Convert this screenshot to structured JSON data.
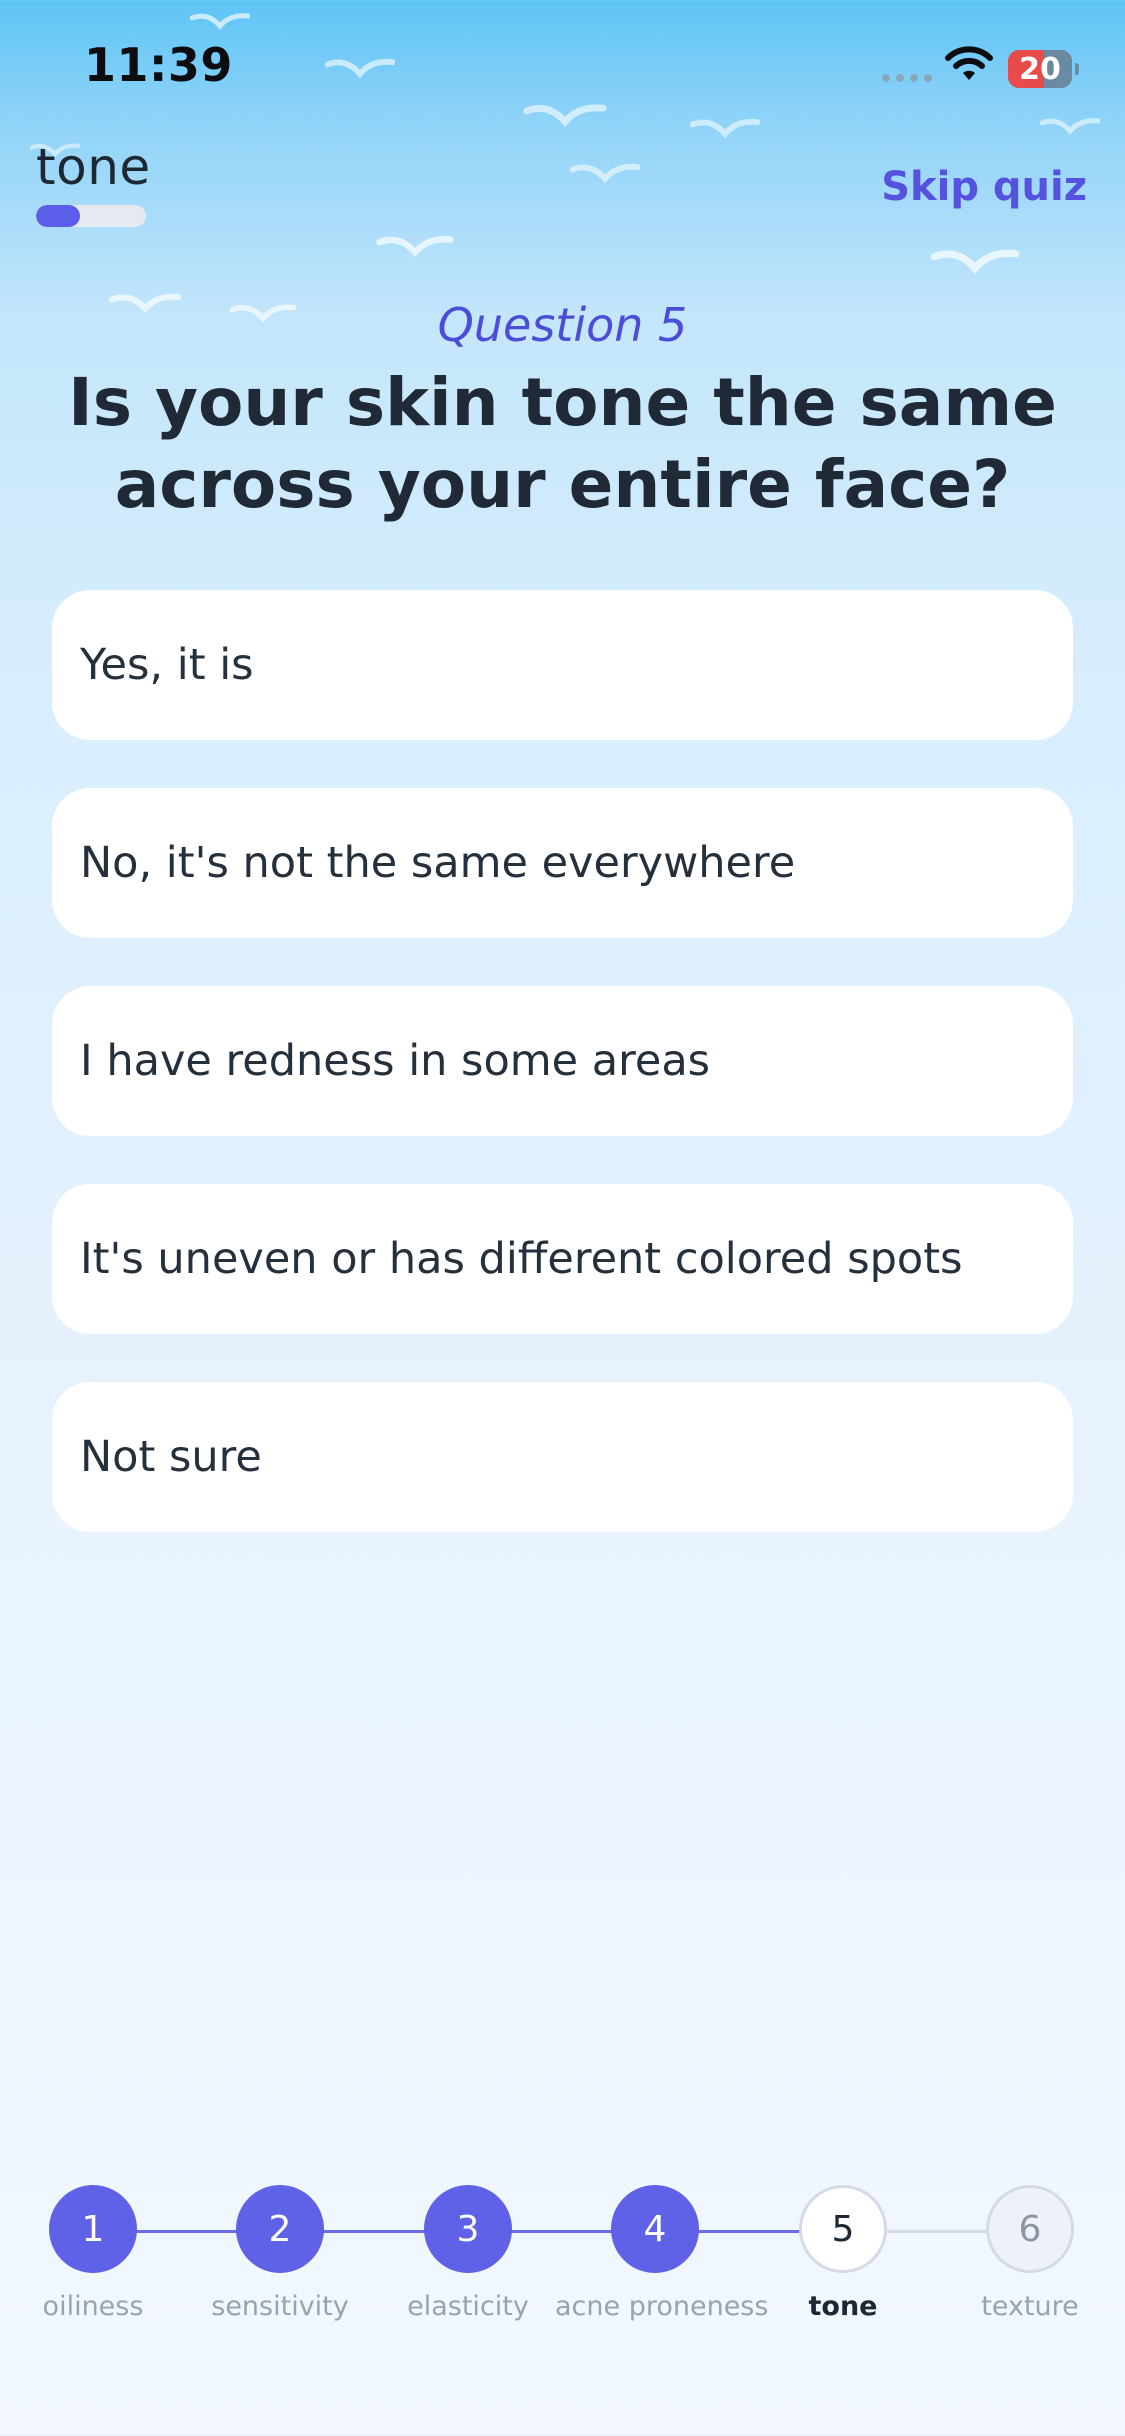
{
  "status_bar": {
    "time": "11:39",
    "battery": "20"
  },
  "header": {
    "section_label": "tone",
    "section_progress": 0.4,
    "skip_label": "Skip quiz"
  },
  "question": {
    "number_label": "Question 5",
    "title": "Is your skin tone the same across your entire face?"
  },
  "options": [
    {
      "label": "Yes, it is"
    },
    {
      "label": "No, it's not the same everywhere"
    },
    {
      "label": "I have redness in some areas"
    },
    {
      "label": "It's uneven or has different colored spots"
    },
    {
      "label": "Not sure"
    }
  ],
  "steps": [
    {
      "number": "1",
      "label": "oiliness",
      "state": "done"
    },
    {
      "number": "2",
      "label": "sensitivity",
      "state": "done"
    },
    {
      "number": "3",
      "label": "elasticity",
      "state": "done"
    },
    {
      "number": "4",
      "label": "acne proneness",
      "state": "done"
    },
    {
      "number": "5",
      "label": "tone",
      "state": "current"
    },
    {
      "number": "6",
      "label": "texture",
      "state": "todo"
    }
  ],
  "colors": {
    "accent": "#5B5EE8",
    "text": "#1F2A36",
    "muted": "#9AA2AE"
  }
}
